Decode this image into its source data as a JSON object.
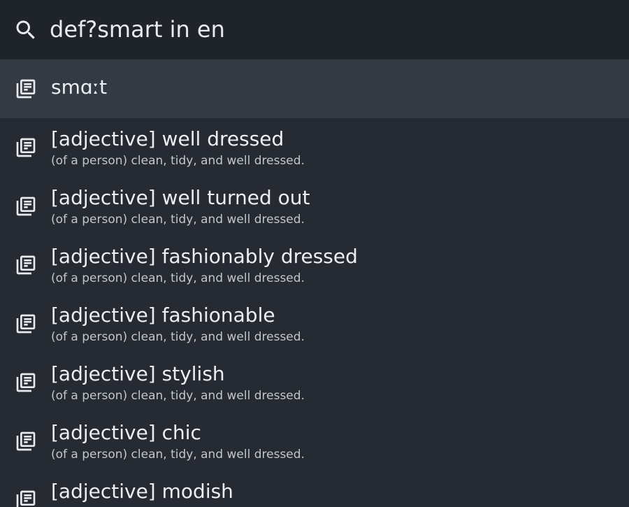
{
  "search": {
    "query": "def?smart in en"
  },
  "results": [
    {
      "title": "smɑːt",
      "subtitle": "",
      "selected": true
    },
    {
      "title": "[adjective] well dressed",
      "subtitle": "(of a person) clean, tidy, and well dressed."
    },
    {
      "title": "[adjective] well turned out",
      "subtitle": "(of a person) clean, tidy, and well dressed."
    },
    {
      "title": "[adjective] fashionably dressed",
      "subtitle": "(of a person) clean, tidy, and well dressed."
    },
    {
      "title": "[adjective] fashionable",
      "subtitle": "(of a person) clean, tidy, and well dressed."
    },
    {
      "title": "[adjective] stylish",
      "subtitle": "(of a person) clean, tidy, and well dressed."
    },
    {
      "title": "[adjective] chic",
      "subtitle": "(of a person) clean, tidy, and well dressed."
    },
    {
      "title": "[adjective] modish",
      "subtitle": ""
    }
  ],
  "icons": {
    "search": "search-icon",
    "result": "library-books-icon"
  }
}
